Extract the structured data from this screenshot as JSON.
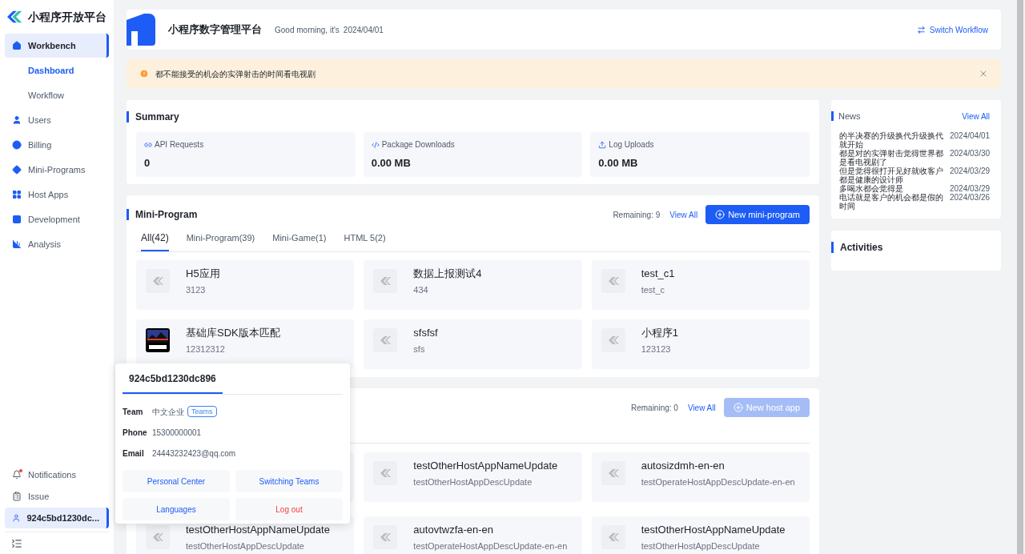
{
  "brand": {
    "title": "小程序开放平台"
  },
  "sidebar": {
    "items": [
      {
        "label": "Workbench",
        "selected": true,
        "children": [
          {
            "label": "Dashboard",
            "selected": true
          },
          {
            "label": "Workflow",
            "selected": false
          }
        ]
      },
      {
        "label": "Users",
        "selected": false
      },
      {
        "label": "Billing",
        "selected": false
      },
      {
        "label": "Mini-Programs",
        "selected": false
      },
      {
        "label": "Host Apps",
        "selected": false
      },
      {
        "label": "Development",
        "selected": false
      },
      {
        "label": "Analysis",
        "selected": false
      }
    ],
    "bottom_items": [
      {
        "label": "Notifications",
        "selected": false,
        "kind": "bell",
        "unread": true
      },
      {
        "label": "Issue",
        "selected": false,
        "kind": "clipboard"
      },
      {
        "label": "924c5bd1230dc...",
        "selected": true,
        "kind": "user"
      }
    ]
  },
  "header": {
    "title": "小程序数字管理平台",
    "greeting": "Good morning, it's",
    "date": "2024/04/01",
    "action": "Switch Workflow"
  },
  "alert": {
    "message": "都不能接受的机会的实弹射击的时间看电视剧"
  },
  "summary": {
    "title": "Summary",
    "stats": [
      {
        "label": "API Requests",
        "value": "0"
      },
      {
        "label": "Package Downloads",
        "value": "0.00 MB"
      },
      {
        "label": "Log Uploads",
        "value": "0.00 MB"
      }
    ]
  },
  "mini_program": {
    "title": "Mini-Program",
    "remaining": "Remaining: 9",
    "view_all": "View All",
    "new_button": {
      "label": "New mini-program",
      "disabled": false
    },
    "tabs": [
      {
        "label": "All(42)",
        "selected": true
      },
      {
        "label": "Mini-Program(39)",
        "selected": false
      },
      {
        "label": "Mini-Game(1)",
        "selected": false
      },
      {
        "label": "HTML 5(2)",
        "selected": false
      }
    ],
    "items": [
      {
        "name": "H5应用",
        "desc": "3123",
        "kind": "default"
      },
      {
        "name": "数据上报测试4",
        "desc": "434",
        "kind": "default"
      },
      {
        "name": "test_c1",
        "desc": "test_c",
        "kind": "default"
      },
      {
        "name": "基础库SDK版本匹配",
        "desc": "12312312",
        "kind": "picture"
      },
      {
        "name": "sfsfsf",
        "desc": "sfs",
        "kind": "default"
      },
      {
        "name": "小程序1",
        "desc": "123123",
        "kind": "default"
      }
    ]
  },
  "host_apps": {
    "remaining": "Remaining: 0",
    "view_all": "View All",
    "new_button": {
      "label": "New host app",
      "disabled": true
    },
    "items": [
      {
        "name": "testOtherHostAppNameUpdate",
        "desc": "testOtherHostAppDescUpdate"
      },
      {
        "name": "autosizdmh-en-en",
        "desc": "testOperateHostAppDescUpdate-en-en"
      },
      {
        "name": "testOtherHostAppNameUpdate",
        "desc": "testOtherHostAppDescUpdate"
      },
      {
        "name": "autovtwzfa-en-en",
        "desc": "testOperateHostAppDescUpdate-en-en"
      },
      {
        "name": "testOtherHostAppNameUpdate",
        "desc": "testOtherHostAppDescUpdate"
      }
    ]
  },
  "news": {
    "title": "News",
    "view_all": "View All",
    "items": [
      {
        "text": "的半决赛的升级换代升级换代就开始",
        "date": "2024/04/01"
      },
      {
        "text": "都是对的实弹射击觉得世界都是看电视剧了",
        "date": "2024/03/30"
      },
      {
        "text": "但是觉得很打开见好就收客户都是健康的设计师",
        "date": "2024/03/29"
      },
      {
        "text": "多喝水都会觉得是",
        "date": "2024/03/29"
      },
      {
        "text": "电话就是客户的机会都是假的时间",
        "date": "2024/03/26"
      }
    ]
  },
  "activities": {
    "title": "Activities"
  },
  "user_popup": {
    "tab": "924c5bd1230dc896",
    "fields": [
      {
        "label": "Team",
        "value": "中文企业",
        "tag": "Teams"
      },
      {
        "label": "Phone",
        "value": "15300000001"
      },
      {
        "label": "Email",
        "value": "24443232423@qq.com"
      }
    ],
    "actions": [
      {
        "label": "Personal Center",
        "kind": "normal"
      },
      {
        "label": "Switching Teams",
        "kind": "normal"
      },
      {
        "label": "Languages",
        "kind": "normal"
      },
      {
        "label": "Log out",
        "kind": "danger"
      }
    ]
  }
}
